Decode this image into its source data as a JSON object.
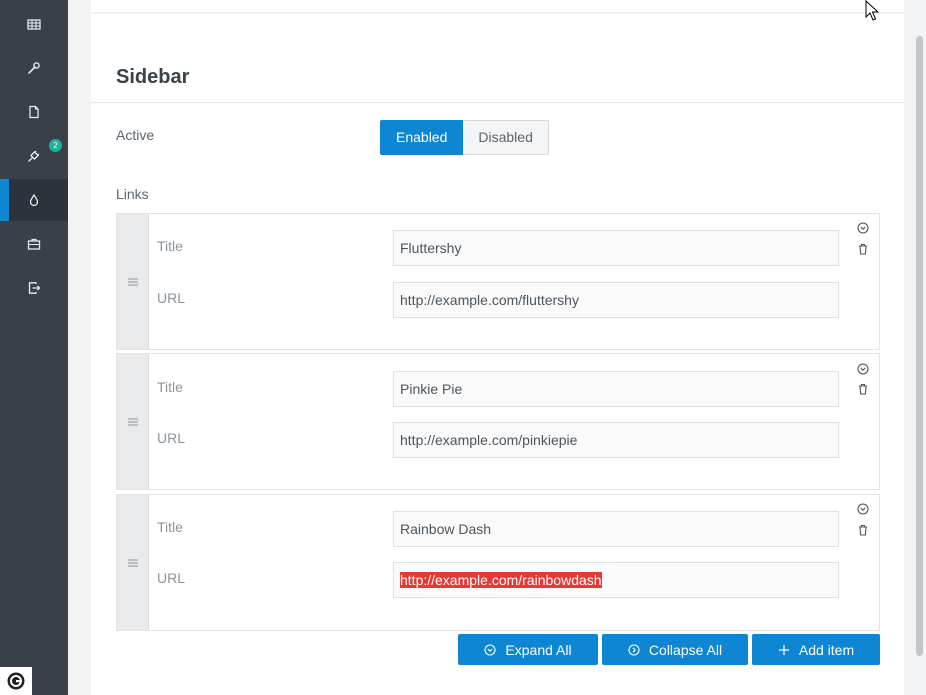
{
  "sidebar": {
    "items": [
      {
        "icon": "table-icon"
      },
      {
        "icon": "wrench-icon"
      },
      {
        "icon": "file-icon"
      },
      {
        "icon": "plug-icon",
        "badge": "2"
      },
      {
        "icon": "droplet-icon",
        "active": true
      },
      {
        "icon": "briefcase-icon"
      },
      {
        "icon": "sign-out-icon"
      }
    ],
    "badge_count": "2"
  },
  "section": {
    "title": "Sidebar",
    "active_label": "Active",
    "enabled_label": "Enabled",
    "disabled_label": "Disabled",
    "active_value": "Enabled",
    "links_label": "Links"
  },
  "links": [
    {
      "title_label": "Title",
      "url_label": "URL",
      "title": "Fluttershy",
      "url": "http://example.com/fluttershy"
    },
    {
      "title_label": "Title",
      "url_label": "URL",
      "title": "Pinkie Pie",
      "url": "http://example.com/pinkiepie"
    },
    {
      "title_label": "Title",
      "url_label": "URL",
      "title": "Rainbow Dash",
      "url": "http://example.com/rainbowdash",
      "url_selected": true
    }
  ],
  "actions": {
    "expand_all": "Expand All",
    "collapse_all": "Collapse All",
    "add_item": "Add item"
  },
  "colors": {
    "accent": "#0e86d3",
    "sidebar_bg": "#39404a",
    "badge": "#1bb299",
    "selection": "#e53935"
  }
}
